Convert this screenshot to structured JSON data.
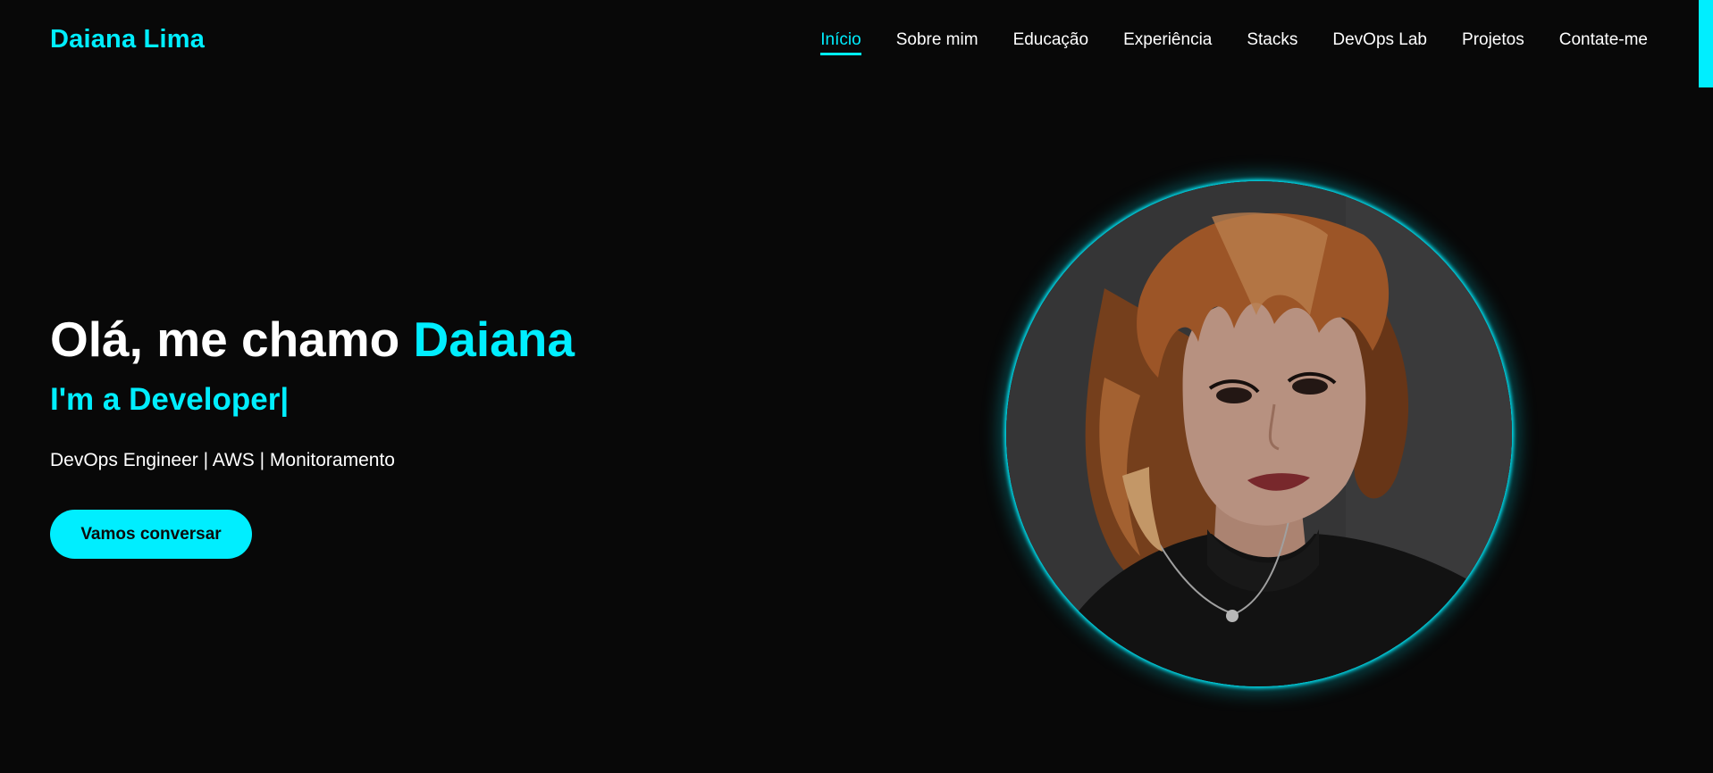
{
  "header": {
    "brand": "Daiana Lima",
    "nav": [
      {
        "label": "Início",
        "active": true
      },
      {
        "label": "Sobre mim"
      },
      {
        "label": "Educação"
      },
      {
        "label": "Experiência"
      },
      {
        "label": "Stacks"
      },
      {
        "label": "DevOps Lab"
      },
      {
        "label": "Projetos"
      },
      {
        "label": "Contate-me"
      }
    ]
  },
  "hero": {
    "greeting": "Olá, me chamo ",
    "name": "Daiana",
    "typed": "I'm a Developer",
    "caret": "|",
    "description": "DevOps Engineer | AWS | Monitoramento",
    "cta_label": "Vamos conversar"
  },
  "colors": {
    "accent": "#00eeff",
    "background": "#080808",
    "text": "#ffffff"
  }
}
